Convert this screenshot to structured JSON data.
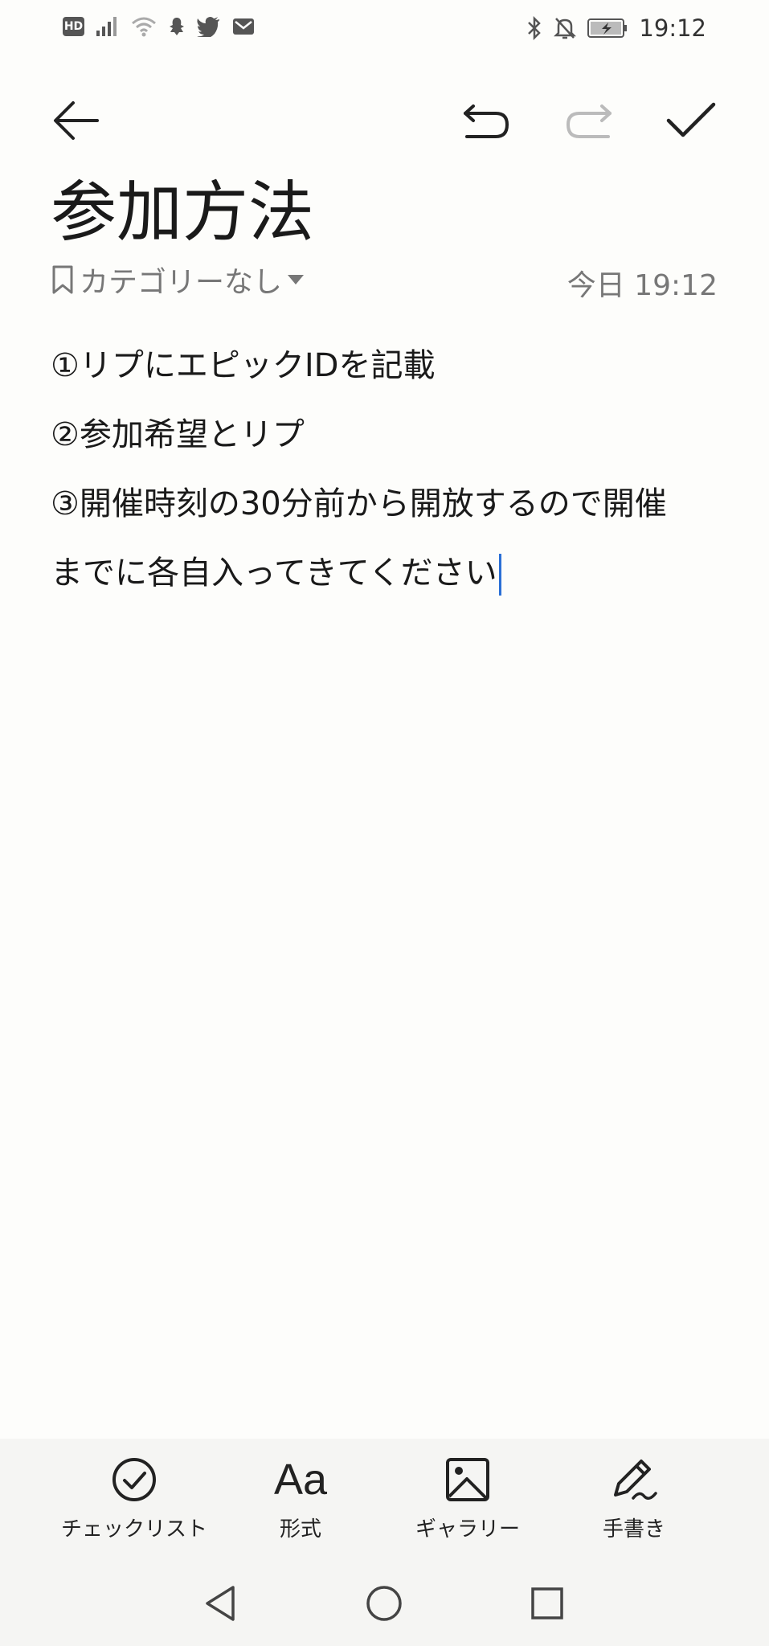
{
  "status_bar": {
    "hd": "HD",
    "time": "19:12",
    "left_icons": [
      "hd-icon",
      "signal-icon",
      "wifi-icon",
      "snapchat-icon",
      "twitter-icon",
      "mail-icon"
    ],
    "right_icons": [
      "bluetooth-icon",
      "mute-icon",
      "battery-icon"
    ]
  },
  "toolbar": {
    "back": "back-arrow-icon",
    "undo": "undo-icon",
    "redo": "redo-icon",
    "done": "checkmark-icon"
  },
  "note": {
    "title": "参加方法",
    "category": "カテゴリーなし",
    "date": "今日 19:12",
    "lines": [
      "①リプにエピックIDを記載",
      "②参加希望とリプ",
      "③開催時刻の30分前から開放するので開催",
      "までに各自入ってきてください"
    ]
  },
  "bottom_tools": [
    {
      "label": "チェックリスト",
      "icon": "checklist-icon"
    },
    {
      "label": "Aa",
      "icon": "format-icon"
    },
    {
      "label": "形式",
      "icon": "format-icon"
    },
    {
      "label": "ギャラリー",
      "icon": "gallery-icon"
    },
    {
      "label": "手書き",
      "icon": "handwriting-icon"
    }
  ],
  "nav": [
    "back-triangle-icon",
    "home-circle-icon",
    "recents-square-icon"
  ],
  "colors": {
    "caret": "#2a6fd6",
    "background": "#fdfdfb",
    "bottom_bar": "#f5f5f3"
  }
}
